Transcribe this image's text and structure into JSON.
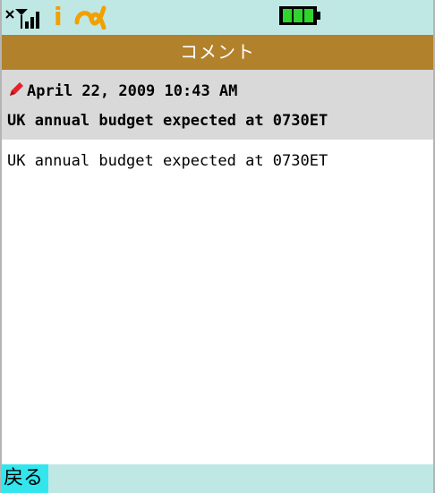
{
  "status": {
    "signal_icon": "signal-icon",
    "info_glyph": "i",
    "carrier_icon": "alpha-carrier-icon",
    "battery_icon": "battery-full-icon",
    "colors": {
      "bar": "#bfe8e4",
      "battery": "#2fd42f",
      "info": "#f2a000"
    }
  },
  "title": "コメント",
  "comment": {
    "date": "April 22, 2009 10:43 AM",
    "subject": "UK annual budget expected at 0730ET",
    "body": "UK annual budget expected at 0730ET"
  },
  "softkeys": {
    "back": "戻る"
  },
  "colors": {
    "title_bar": "#b2812b",
    "header_bg": "#d9d9d9",
    "softkey_highlight": "#33e6ee"
  }
}
